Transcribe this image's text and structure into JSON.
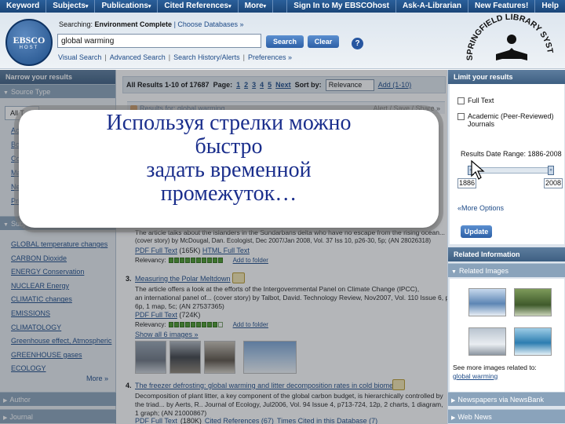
{
  "topnav": {
    "items": [
      {
        "label": "Keyword",
        "caret": false
      },
      {
        "label": "Subjects",
        "caret": true
      },
      {
        "label": "Publications",
        "caret": true
      },
      {
        "label": "Cited References",
        "caret": true
      },
      {
        "label": "More",
        "caret": true
      }
    ],
    "right_items": [
      "Sign In to My EBSCOhost",
      "Ask-A-Librarian",
      "New Features!",
      "Help"
    ]
  },
  "header": {
    "logo_text": "EBSCO",
    "logo_subtext": "HOST",
    "searching_label": "Searching:",
    "database": "Environment Complete",
    "choose_databases": "| Choose Databases »",
    "search_value": "global warming",
    "search_button": "Search",
    "clear_button": "Clear",
    "help": "?",
    "subnav": [
      "Visual Search",
      "Advanced Search",
      "Search History/Alerts",
      "Preferences »"
    ],
    "library_logo_text": "SPRINGFIELD LIBRARY SYSTEM"
  },
  "left": {
    "narrow_title": "Narrow your results",
    "source_type_title": "Source Type",
    "all_types": "All T",
    "cut_links": [
      "Ac",
      "Bo",
      "Co",
      "Ma",
      "Ne",
      "Pri"
    ],
    "subject_title": "Subje",
    "subjects": [
      "GLOBAL temperature changes",
      "CARBON Dioxide",
      "ENERGY Conservation",
      "NUCLEAR Energy",
      "CLIMATIC changes",
      "EMISSIONS",
      "CLIMATOLOGY",
      "Greenhouse effect, Atmospheric",
      "GREENHOUSE gases",
      "ECOLOGY"
    ],
    "more": "More »",
    "author": "Author",
    "journal": "Journal"
  },
  "main": {
    "results_label": "All Results 1-10 of 17687",
    "page_label": "Page:",
    "pages": [
      "1",
      "2",
      "3",
      "4",
      "5",
      "Next"
    ],
    "sort_label": "Sort by:",
    "sort_value": "Relevance",
    "add_range": "Add (1-10)",
    "results_for": "Results for: global warming",
    "alert_save": "Alert / Save / Share »",
    "r2_snippet1": "The article talks about the islanders in the Sundarbans delta who have no escape from the rising ocean...",
    "r2_snippet2": "(cover story) by McDougal, Dan. Ecologist, Dec 2007/Jan 2008, Vol. 37 Iss 10, p26-30, 5p; (AN 28026318)",
    "r2_links": [
      "PDF Full Text",
      "(165K)",
      "HTML Full Text"
    ],
    "relevancy_label": "Relevancy:",
    "add_to_folder": "Add to folder",
    "r3_num": "3.",
    "r3_title": "Measuring the Polar Meltdown",
    "r3_text": [
      "The article offers a look at the efforts of the Intergovernmental Panel on Climate Change (IPCC),",
      "an international panel of... (cover story) by Talbot, David. Technology Review, Nov2007, Vol. 110 Issue 6, p54-59,",
      "6p, 1 map, 5c; (AN 27537365)"
    ],
    "r3_links": [
      "PDF Full Text",
      "(724K)"
    ],
    "show_images": "Show all 6 images »",
    "r4_num": "4.",
    "r4_title": "The freezer defrosting: global warming and litter decomposition rates in cold biomes",
    "r4_text": [
      "Decomposition of plant litter, a key component of the global carbon budget, is hierarchically controlled by",
      "the triad... by Aerts, R.. Journal of Ecology, Jul2006, Vol. 94 Issue 4, p713-724, 12p, 2 charts, 1 diagram,",
      "1 graph; (AN 21000867)"
    ],
    "r4_links": [
      "PDF Full Text",
      "(180K)",
      "Cited References (67)",
      "Times Cited in this Database (7)"
    ]
  },
  "right": {
    "limit_title": "Limit your results",
    "full_text": "Full Text",
    "peer_reviewed_1": "Academic (Peer-Reviewed)",
    "peer_reviewed_2": "Journals",
    "date_range": "Results Date Range: 1886-2008",
    "year_from": "1886",
    "year_to": "2008",
    "more_options": "«More Options",
    "update": "Update",
    "related_info": "Related Information",
    "related_images": "Related Images",
    "see_more_1": "See more images related to:",
    "see_more_2": "global warming",
    "newspapers": "Newspapers via NewsBank",
    "web_news": "Web News"
  },
  "callout": {
    "lines": [
      "Используя стрелки можно",
      "быстро",
      "задать временной",
      "промежуток…"
    ]
  },
  "colors": {
    "accent": "#1d4a87",
    "panel_header": "#3e5f82",
    "callout_text": "#1a2e8c",
    "relevancy_green": "#4a9a2a"
  }
}
